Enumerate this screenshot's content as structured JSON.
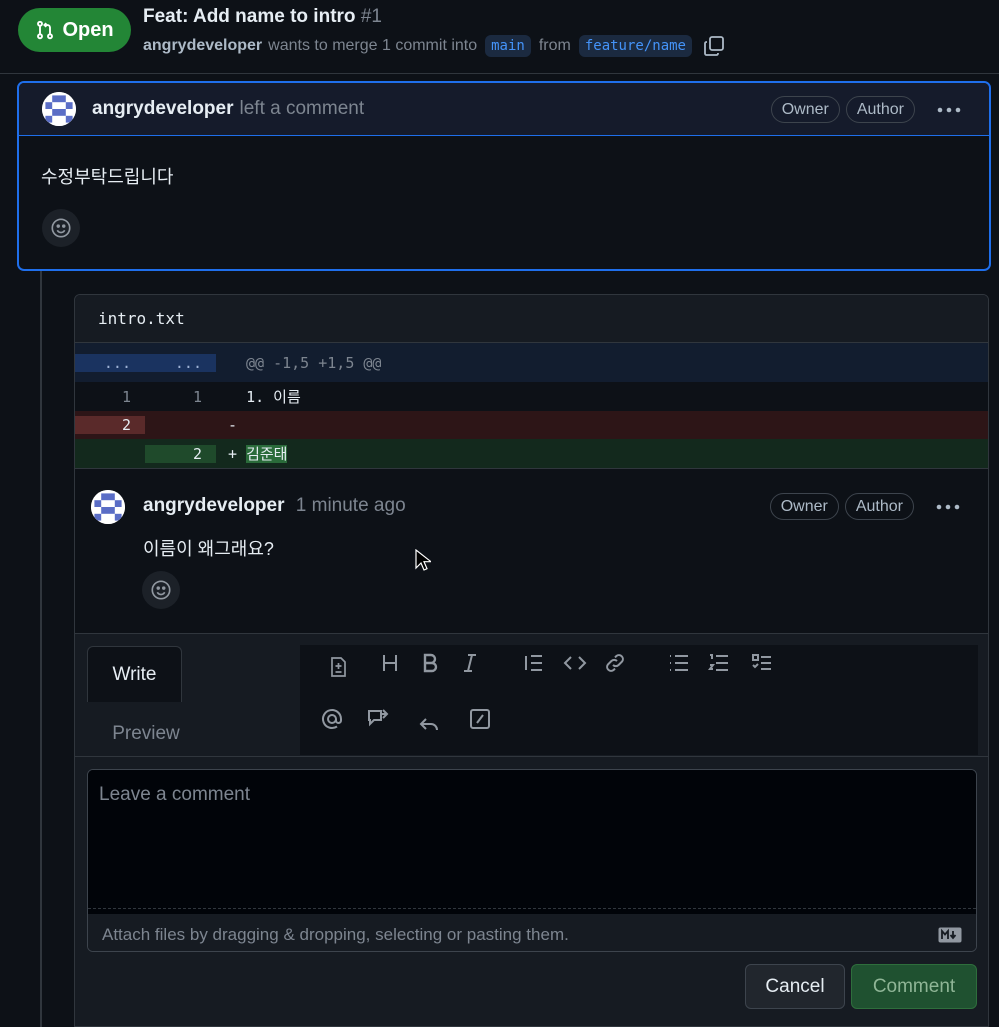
{
  "header": {
    "state": "Open",
    "title": "Feat: Add name to intro",
    "number": "#1",
    "author": "angrydeveloper",
    "merge_text": "wants to merge 1 commit into",
    "base_branch": "main",
    "from_text": "from",
    "head_branch": "feature/name"
  },
  "comment": {
    "author": "angrydeveloper",
    "action": "left a comment",
    "tags": [
      "Owner",
      "Author"
    ],
    "body": "수정부탁드립니다"
  },
  "diff": {
    "file": "intro.txt",
    "hunk": {
      "left": "...",
      "right": "...",
      "text": "@@ -1,5 +1,5 @@"
    },
    "rows": [
      {
        "type": "context",
        "left": "1",
        "right": "1",
        "sign": " ",
        "text": "1. 이름"
      },
      {
        "type": "deletion",
        "left": "2",
        "right": "",
        "sign": "-",
        "text": ""
      },
      {
        "type": "addition",
        "left": "",
        "right": "2",
        "sign": "+",
        "text": "김준태"
      }
    ]
  },
  "reply": {
    "author": "angrydeveloper",
    "time": "1 minute ago",
    "tags": [
      "Owner",
      "Author"
    ],
    "body": "이름이 왜그래요?"
  },
  "editor": {
    "tab_write": "Write",
    "tab_preview": "Preview",
    "placeholder": "Leave a comment",
    "attach_text": "Attach files by dragging & dropping, selecting or pasting them.",
    "cancel": "Cancel",
    "submit": "Comment",
    "toolbar_icons": [
      "suggestion-icon",
      "heading-icon",
      "bold-icon",
      "italic-icon",
      "quote-icon",
      "code-icon",
      "link-icon",
      "bulleted-list-icon",
      "numbered-list-icon",
      "task-list-icon",
      "mention-icon",
      "cross-reference-icon",
      "saved-reply-icon",
      "slash-command-icon"
    ]
  },
  "colors": {
    "open_green": "#238636",
    "accent_blue": "#1f6feb",
    "bg": "#0d1117"
  }
}
